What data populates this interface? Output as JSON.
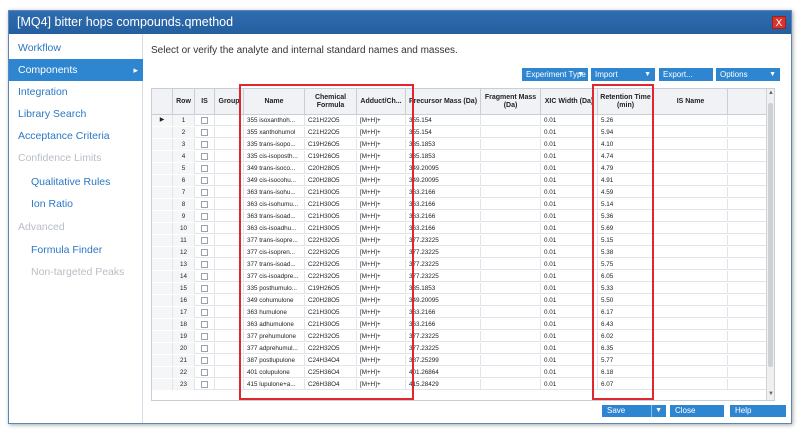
{
  "window": {
    "title": "[MQ4] bitter hops compounds.qmethod",
    "close_label": "X"
  },
  "sidebar": {
    "items": [
      {
        "label": "Workflow"
      },
      {
        "label": "Components",
        "chevron": "▸"
      },
      {
        "label": "Integration"
      },
      {
        "label": "Library Search"
      },
      {
        "label": "Acceptance Criteria"
      },
      {
        "label": "Confidence Limits"
      },
      {
        "label": "Qualitative Rules"
      },
      {
        "label": "Ion Ratio"
      },
      {
        "label": "Advanced"
      },
      {
        "label": "Formula Finder"
      },
      {
        "label": "Non-targeted Peaks"
      }
    ]
  },
  "main": {
    "instruction": "Select or verify the analyte and internal standard names and masses."
  },
  "toolbar": {
    "experiment_type": "Experiment Type",
    "import": "Import",
    "export": "Export...",
    "options": "Options",
    "dropdown_arrow": "▼"
  },
  "table": {
    "columns": [
      "Row",
      "IS",
      "Group",
      "Name",
      "Chemical Formula",
      "Adduct/Ch...",
      "Precursor Mass (Da)",
      "Fragment Mass (Da)",
      "XIC Width (Da)",
      "Retention Time (min)",
      "IS Name"
    ],
    "current_row_marker": "▶",
    "rows": [
      [
        "1",
        "355 isoxanthoh...",
        "C21H22O5",
        "[M+H]+",
        "355.154",
        "0.01",
        "5.26"
      ],
      [
        "2",
        "355 xanthohumol",
        "C21H22O5",
        "[M+H]+",
        "355.154",
        "0.01",
        "5.94"
      ],
      [
        "3",
        "335 trans-isopo...",
        "C19H26O5",
        "[M+H]+",
        "335.1853",
        "0.01",
        "4.10"
      ],
      [
        "4",
        "335 cis-isoposth...",
        "C19H26O5",
        "[M+H]+",
        "335.1853",
        "0.01",
        "4.74"
      ],
      [
        "5",
        "349 trans-isoco...",
        "C20H28O5",
        "[M+H]+",
        "349.20095",
        "0.01",
        "4.79"
      ],
      [
        "6",
        "349 cis-isocohu...",
        "C20H28O5",
        "[M+H]+",
        "349.20095",
        "0.01",
        "4.91"
      ],
      [
        "7",
        "363 trans-isohu...",
        "C21H30O5",
        "[M+H]+",
        "363.2166",
        "0.01",
        "4.59"
      ],
      [
        "8",
        "363 cis-isohumu...",
        "C21H30O5",
        "[M+H]+",
        "363.2166",
        "0.01",
        "5.14"
      ],
      [
        "9",
        "363 trans-isoad...",
        "C21H30O5",
        "[M+H]+",
        "363.2166",
        "0.01",
        "5.36"
      ],
      [
        "10",
        "363 cis-isoadhu...",
        "C21H30O5",
        "[M+H]+",
        "363.2166",
        "0.01",
        "5.69"
      ],
      [
        "11",
        "377 trans-isopre...",
        "C22H32O5",
        "[M+H]+",
        "377.23225",
        "0.01",
        "5.15"
      ],
      [
        "12",
        "377 cis-isopren...",
        "C22H32O5",
        "[M+H]+",
        "377.23225",
        "0.01",
        "5.38"
      ],
      [
        "13",
        "377 trans-isoad...",
        "C22H32O5",
        "[M+H]+",
        "377.23225",
        "0.01",
        "5.75"
      ],
      [
        "14",
        "377 cis-isoadpre...",
        "C22H32O5",
        "[M+H]+",
        "377.23225",
        "0.01",
        "6.05"
      ],
      [
        "15",
        "335 posthumulo...",
        "C19H26O5",
        "[M+H]+",
        "335.1853",
        "0.01",
        "5.33"
      ],
      [
        "16",
        "349 cohumulone",
        "C20H28O5",
        "[M+H]+",
        "349.20095",
        "0.01",
        "5.50"
      ],
      [
        "17",
        "363 humulone",
        "C21H30O5",
        "[M+H]+",
        "363.2166",
        "0.01",
        "6.17"
      ],
      [
        "18",
        "363 adhumulone",
        "C21H30O5",
        "[M+H]+",
        "363.2166",
        "0.01",
        "6.43"
      ],
      [
        "19",
        "377 prehumulone",
        "C22H32O5",
        "[M+H]+",
        "377.23225",
        "0.01",
        "6.02"
      ],
      [
        "20",
        "377 adprehumul...",
        "C22H32O5",
        "[M+H]+",
        "377.23225",
        "0.01",
        "6.35"
      ],
      [
        "21",
        "387 postlupulone",
        "C24H34O4",
        "[M+H]+",
        "387.25299",
        "0.01",
        "5.77"
      ],
      [
        "22",
        "401 colupulone",
        "C25H36O4",
        "[M+H]+",
        "401.26864",
        "0.01",
        "6.18"
      ],
      [
        "23",
        "415 lupulone+a...",
        "C26H38O4",
        "[M+H]+",
        "415.28429",
        "0.01",
        "6.07"
      ]
    ]
  },
  "footer": {
    "save": "Save",
    "close": "Close",
    "help": "Help",
    "dropdown_arrow": "▼"
  },
  "colors": {
    "accent": "#2f86d0",
    "titlebar": "#2a67a8",
    "highlight": "#e0262e",
    "disabled": "#b8bec6"
  }
}
